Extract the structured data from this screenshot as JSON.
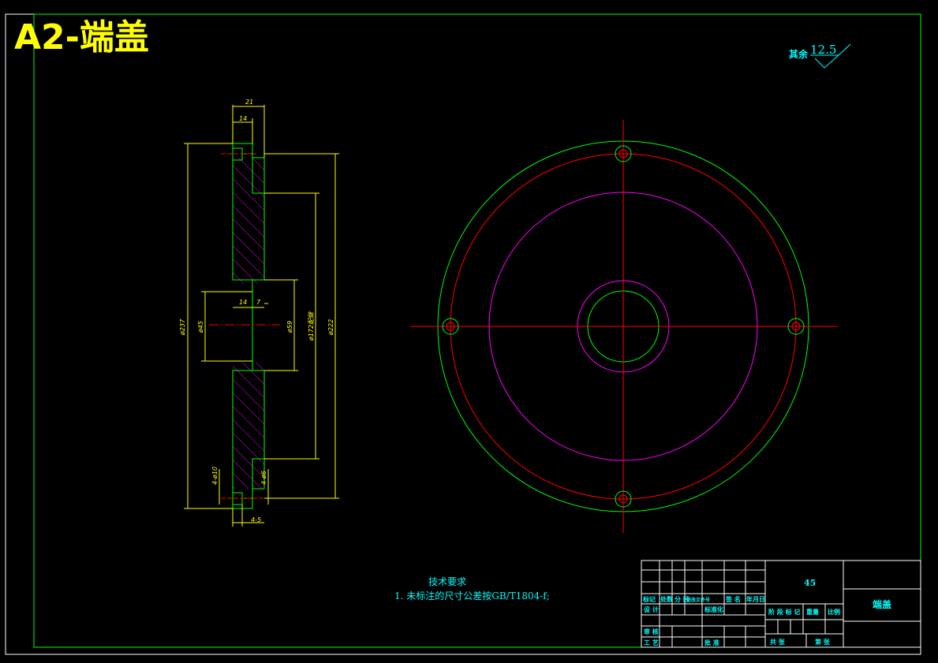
{
  "sheet": {
    "title": "A2-端盖"
  },
  "roughness": {
    "label": "其余",
    "value": "12.5"
  },
  "dimensions": {
    "top_21": "21",
    "top_14": "14",
    "mid_14": "14",
    "mid_7": "7",
    "dia_237": "ø237",
    "dia_45": "ø45",
    "dia_59": "ø59",
    "dia_172": "ø172配做",
    "dia_222": "ø222",
    "holes_10": "4-ø10",
    "holes_6": "4-ø6",
    "depth_5": "4-5"
  },
  "notes": {
    "heading": "技术要求",
    "line1": "1. 未标注的尺寸公差按GB/T1804-f;"
  },
  "title_block": {
    "material": "45",
    "part_name": "端盖",
    "row_labels": [
      "标记",
      "处数",
      "分 区",
      "更改文件号",
      "签 名",
      "年月日"
    ],
    "design": "设 计",
    "standardization": "标准化",
    "stage_labels": [
      "阶 段 标 记",
      "重量",
      "比例"
    ],
    "review": "审 核",
    "process": "工 艺",
    "approve": "批 准",
    "total": "共   张",
    "sheet_no": "第   张"
  },
  "colors": {
    "frame": "#00ff00",
    "dimension": "#ffff00",
    "center": "#ff0000",
    "pitch_circle": "#ff00ff",
    "text": "#00ffff",
    "hatch": "#ff00ff"
  }
}
